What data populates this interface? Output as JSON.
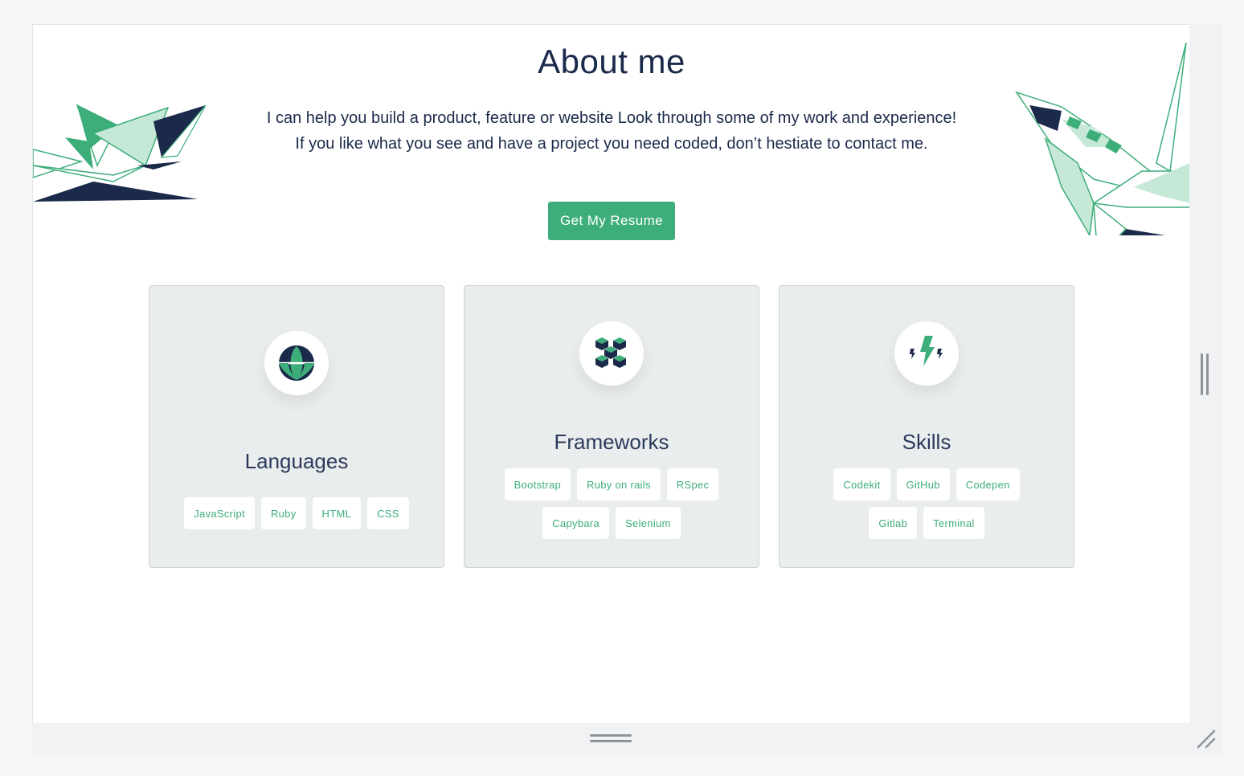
{
  "about": {
    "title": "About me",
    "intro": "I can help you build a product, feature or website Look through some of my work and experience! If you like what you see and have a project you need coded, don’t hestiate to contact me.",
    "resume_button": "Get My Resume"
  },
  "cards": [
    {
      "title": "Languages",
      "icon": "globe-icon",
      "tags": [
        "JavaScript",
        "Ruby",
        "HTML",
        "CSS"
      ]
    },
    {
      "title": "Frameworks",
      "icon": "cubes-icon",
      "tags": [
        "Bootstrap",
        "Ruby on rails",
        "RSpec",
        "Capybara",
        "Selenium"
      ]
    },
    {
      "title": "Skills",
      "icon": "lightning-icon",
      "tags": [
        "Codekit",
        "GitHub",
        "Codepen",
        "Gitlab",
        "Terminal"
      ]
    }
  ],
  "colors": {
    "accent": "#3dae7a",
    "navy": "#1b2a4a",
    "card_bg": "#eaeded",
    "mint": "#c6e8d6"
  },
  "decorations": [
    "origami-crane-left",
    "origami-crane-right"
  ]
}
